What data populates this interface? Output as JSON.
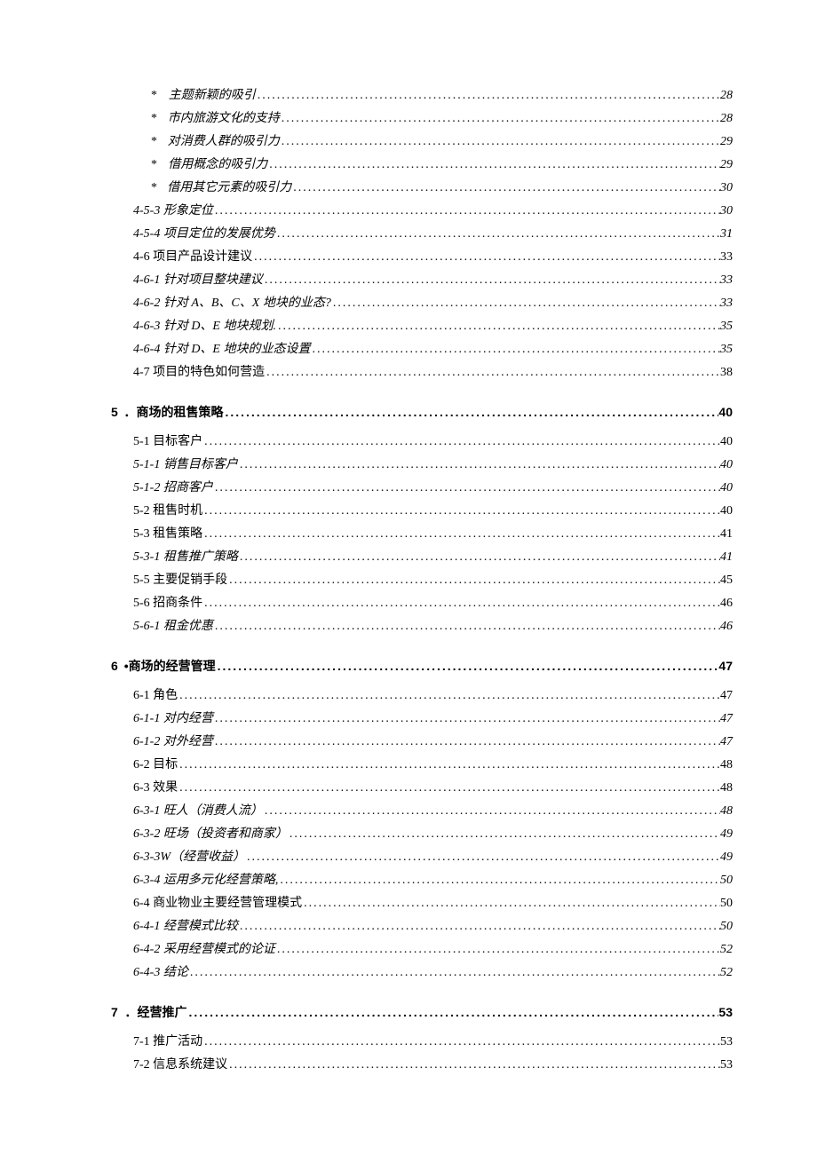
{
  "entries": [
    {
      "type": "bullet",
      "label": "主题新颖的吸引",
      "page": "28"
    },
    {
      "type": "bullet",
      "label": "市内旅游文化的支持",
      "page": "28"
    },
    {
      "type": "bullet",
      "label": "对消费人群的吸引力",
      "page": "29"
    },
    {
      "type": "bullet",
      "label": "借用概念的吸引力",
      "page": "29"
    },
    {
      "type": "bullet",
      "label": "借用其它元素的吸引力",
      "page": "30"
    },
    {
      "type": "l3",
      "label": "4-5-3 形象定位",
      "page": "30"
    },
    {
      "type": "l3",
      "label": "4-5-4 项目定位的发展优势",
      "page": "31"
    },
    {
      "type": "l2",
      "label": "4-6 项目产品设计建议",
      "page": "33"
    },
    {
      "type": "l3",
      "label": "4-6-1 针对项目整块建议",
      "page": "33"
    },
    {
      "type": "l3",
      "label": "4-6-2 针对 A、B、C、X 地块的业态?",
      "page": "33"
    },
    {
      "type": "l3",
      "label": "4-6-3 针对 D、E 地块规划.",
      "page": "35"
    },
    {
      "type": "l3",
      "label": "4-6-4 针对 D、E 地块的业态设置",
      "page": "35"
    },
    {
      "type": "l2",
      "label": "4-7 项目的特色如何营造",
      "page": "38"
    },
    {
      "type": "chapter",
      "num": "5",
      "label": "．商场的租售策略",
      "page": "40"
    },
    {
      "type": "l2",
      "label": "5-1 目标客户",
      "page": "40"
    },
    {
      "type": "l3",
      "label": "5-1-1 销售目标客户",
      "page": "40"
    },
    {
      "type": "l3",
      "label": "5-1-2 招商客户",
      "page": "40"
    },
    {
      "type": "l2",
      "label": "5-2 租售时机",
      "page": "40"
    },
    {
      "type": "l2",
      "label": "5-3 租售策略",
      "page": "41"
    },
    {
      "type": "l3",
      "label": "5-3-1 租售推广策略",
      "page": "41"
    },
    {
      "type": "l2",
      "label": "5-5 主要促销手段",
      "page": "45"
    },
    {
      "type": "l2",
      "label": "5-6 招商条件",
      "page": "46"
    },
    {
      "type": "l3",
      "label": "5-6-1 租金优惠",
      "page": "46"
    },
    {
      "type": "chapter",
      "num": "6",
      "label": "•商场的经营管理",
      "page": "47"
    },
    {
      "type": "l2",
      "label": "6-1 角色",
      "page": "47"
    },
    {
      "type": "l3",
      "label": "6-1-1 对内经营",
      "page": "47"
    },
    {
      "type": "l3",
      "label": "6-1-2 对外经营",
      "page": "47"
    },
    {
      "type": "l2",
      "label": "6-2 目标",
      "page": "48"
    },
    {
      "type": "l2",
      "label": "6-3 效果",
      "page": "48"
    },
    {
      "type": "l3",
      "label": "6-3-1 旺人（消费人流）",
      "page": "48"
    },
    {
      "type": "l3",
      "label": "6-3-2 旺场（投资者和商家）",
      "page": "49"
    },
    {
      "type": "l3",
      "label": "6-3-3W（经营收益）",
      "page": "49"
    },
    {
      "type": "l3",
      "label": "6-3-4 运用多元化经营策略,",
      "page": "50"
    },
    {
      "type": "l2",
      "label": "6-4 商业物业主要经营管理模式",
      "page": "50"
    },
    {
      "type": "l3",
      "label": "6-4-1 经营模式比较",
      "page": "50"
    },
    {
      "type": "l3",
      "label": "6-4-2 采用经营模式的论证",
      "page": "52"
    },
    {
      "type": "l3",
      "label": "6-4-3 结论",
      "page": "52"
    },
    {
      "type": "chapter",
      "num": "7",
      "label": "．经营推广",
      "page": "53"
    },
    {
      "type": "l2",
      "label": "7-1 推广活动",
      "page": "53"
    },
    {
      "type": "l2",
      "label": "7-2 信息系统建议",
      "page": "53"
    }
  ],
  "bullet_marker": "*"
}
